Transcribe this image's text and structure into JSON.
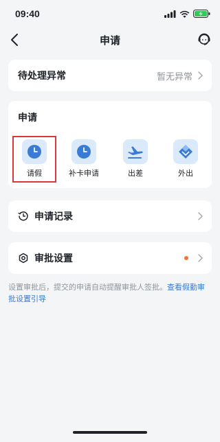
{
  "status_bar": {
    "time": "09:40"
  },
  "nav": {
    "title": "申请",
    "back_icon": "chevron-left-icon",
    "service_icon": "customer-service-icon"
  },
  "exceptions": {
    "label": "待处理异常",
    "value": "暂无异常"
  },
  "apply": {
    "title": "申请",
    "items": [
      {
        "label": "请假",
        "icon": "clock-icon"
      },
      {
        "label": "补卡申请",
        "icon": "clock-icon"
      },
      {
        "label": "出差",
        "icon": "airplane-icon"
      },
      {
        "label": "外出",
        "icon": "diamond-outing-icon"
      }
    ],
    "selected_index": 0
  },
  "records": {
    "label": "申请记录",
    "icon": "history-icon"
  },
  "settings": {
    "label": "审批设置",
    "icon": "gear-icon",
    "dot_color": "#f0753a"
  },
  "footer": {
    "text": "设置审批后，提交的申请自动提醒审批人签批。",
    "link": "查看假勤审批设置引导"
  },
  "colors": {
    "accent": "#3a7bd5",
    "tile_bg": "#dbeafb",
    "highlight": "#d9363e"
  }
}
